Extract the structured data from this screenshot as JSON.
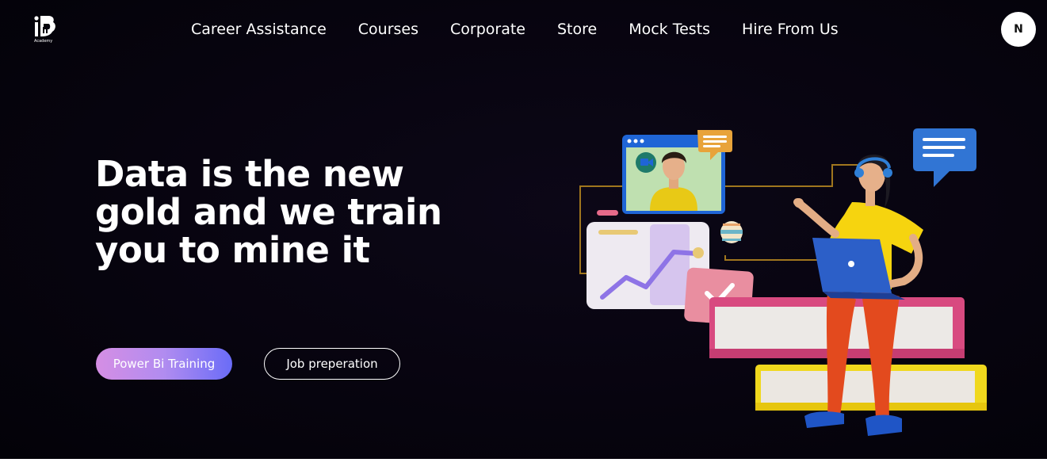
{
  "brand": {
    "logo_text": "iB",
    "logo_subtext": "Academy"
  },
  "nav": {
    "items": [
      {
        "label": "Career Assistance"
      },
      {
        "label": "Courses"
      },
      {
        "label": "Corporate"
      },
      {
        "label": "Store"
      },
      {
        "label": "Mock Tests"
      },
      {
        "label": "Hire From Us"
      }
    ]
  },
  "user": {
    "avatar_initial": "N"
  },
  "hero": {
    "headline_lines": [
      "Data is the new",
      "gold and we train",
      "you to mine it"
    ],
    "primary_button": "Power Bi Training",
    "secondary_button": "Job preperation"
  },
  "colors": {
    "background": "#07040f",
    "button_gradient_start": "#d58ee4",
    "button_gradient_end": "#6a6cf7"
  },
  "illustration": {
    "icon": "person-with-laptop-on-books-illustration"
  }
}
